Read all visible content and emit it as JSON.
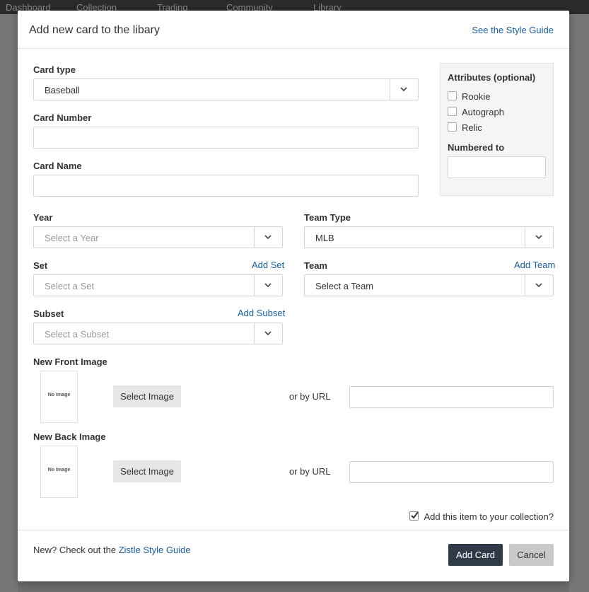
{
  "background": {
    "nav_items": [
      "Dashboard",
      "Collection",
      "Trading",
      "Community",
      "Library"
    ]
  },
  "modal": {
    "title": "Add new card to the libary",
    "style_guide_link": "See the Style Guide"
  },
  "form": {
    "card_type": {
      "label": "Card type",
      "value": "Baseball"
    },
    "card_number": {
      "label": "Card Number",
      "value": ""
    },
    "card_name": {
      "label": "Card Name",
      "value": ""
    },
    "year": {
      "label": "Year",
      "placeholder": "Select a Year"
    },
    "team_type": {
      "label": "Team Type",
      "value": "MLB"
    },
    "set": {
      "label": "Set",
      "placeholder": "Select a Set",
      "add_label": "Add Set"
    },
    "team": {
      "label": "Team",
      "value": "Select a Team",
      "add_label": "Add Team"
    },
    "subset": {
      "label": "Subset",
      "placeholder": "Select a Subset",
      "add_label": "Add Subset"
    }
  },
  "attributes": {
    "title": "Attributes (optional)",
    "options": [
      {
        "label": "Rookie",
        "checked": false
      },
      {
        "label": "Autograph",
        "checked": false
      },
      {
        "label": "Relic",
        "checked": false
      }
    ],
    "numbered_to_label": "Numbered to",
    "numbered_to_value": ""
  },
  "images": {
    "front": {
      "label": "New Front Image",
      "thumb_text": "No Image",
      "button": "Select Image",
      "url_label": "or by URL",
      "url_value": ""
    },
    "back": {
      "label": "New Back Image",
      "thumb_text": "No Image",
      "button": "Select Image",
      "url_label": "or by URL",
      "url_value": ""
    }
  },
  "collection_checkbox": {
    "label": "Add this item to your collection?",
    "checked": true
  },
  "footer": {
    "note_prefix": "New? Check out the",
    "note_link": "Zistle Style Guide",
    "add_button": "Add Card",
    "cancel_button": "Cancel"
  },
  "colors": {
    "link": "#1a5ea3",
    "primary_button": "#2f3b47",
    "cancel_button": "#c9c9c9"
  }
}
